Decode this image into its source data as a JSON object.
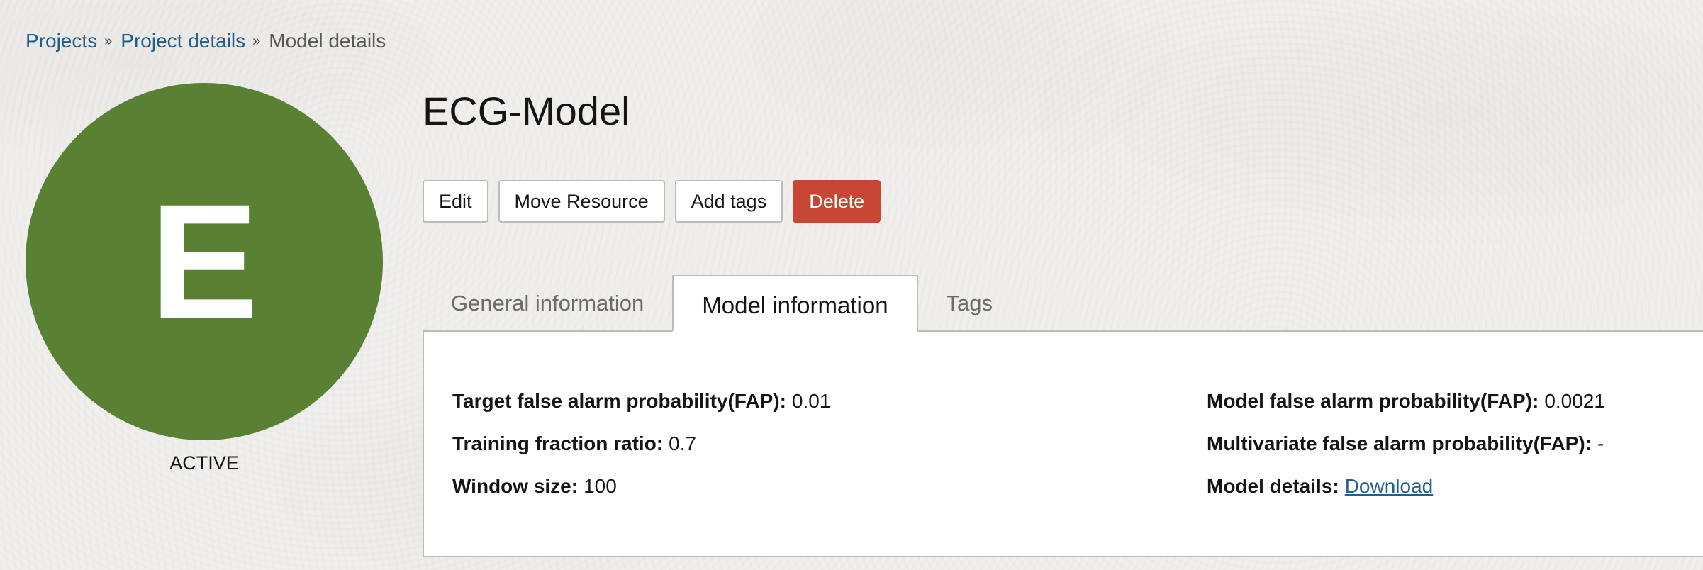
{
  "breadcrumb": {
    "items": [
      "Projects",
      "Project details"
    ],
    "current": "Model details",
    "separator": "»"
  },
  "avatar": {
    "letter": "E",
    "color": "#5a8133"
  },
  "status": "ACTIVE",
  "title": "ECG-Model",
  "actions": {
    "edit": "Edit",
    "move": "Move Resource",
    "add_tags": "Add tags",
    "delete": "Delete",
    "danger_color": "#c74634"
  },
  "tabs": {
    "general": "General information",
    "model": "Model information",
    "tags": "Tags",
    "active": "Model information"
  },
  "model_info": {
    "left": [
      {
        "label": "Target false alarm probability(FAP):",
        "value": "0.01"
      },
      {
        "label": "Training fraction ratio:",
        "value": "0.7"
      },
      {
        "label": "Window size:",
        "value": "100"
      }
    ],
    "right": [
      {
        "label": "Model false alarm probability(FAP):",
        "value": "0.0021"
      },
      {
        "label": "Multivariate false alarm probability(FAP):",
        "value": "-"
      },
      {
        "label": "Model details:",
        "link": "Download"
      }
    ]
  },
  "colors": {
    "link": "#1f5f8b"
  }
}
